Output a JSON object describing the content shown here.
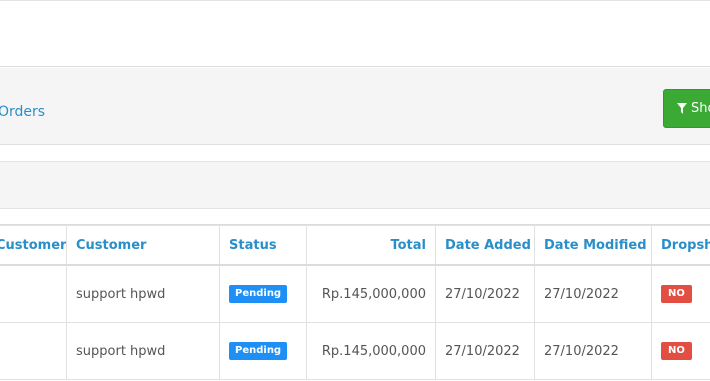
{
  "breadcrumb": {
    "label": "Orders"
  },
  "filter_button": {
    "label": "Sho",
    "icon": "filter-icon"
  },
  "table": {
    "columns": [
      "Customer ID",
      "Customer",
      "Status",
      "Total",
      "Date Added",
      "Date Modified",
      "Dropship"
    ],
    "rows": [
      {
        "customer_id": "",
        "customer": "support hpwd",
        "status": "Pending",
        "total": "Rp.145,000,000",
        "date_added": "27/10/2022",
        "date_modified": "27/10/2022",
        "dropship": "NO"
      },
      {
        "customer_id": "",
        "customer": "support hpwd",
        "status": "Pending",
        "total": "Rp.145,000,000",
        "date_added": "27/10/2022",
        "date_modified": "27/10/2022",
        "dropship": "NO"
      }
    ]
  },
  "colors": {
    "link": "#2a8fc9",
    "success": "#3aaa35",
    "status_pending": "#1e90f5",
    "badge_no": "#e24e42"
  }
}
